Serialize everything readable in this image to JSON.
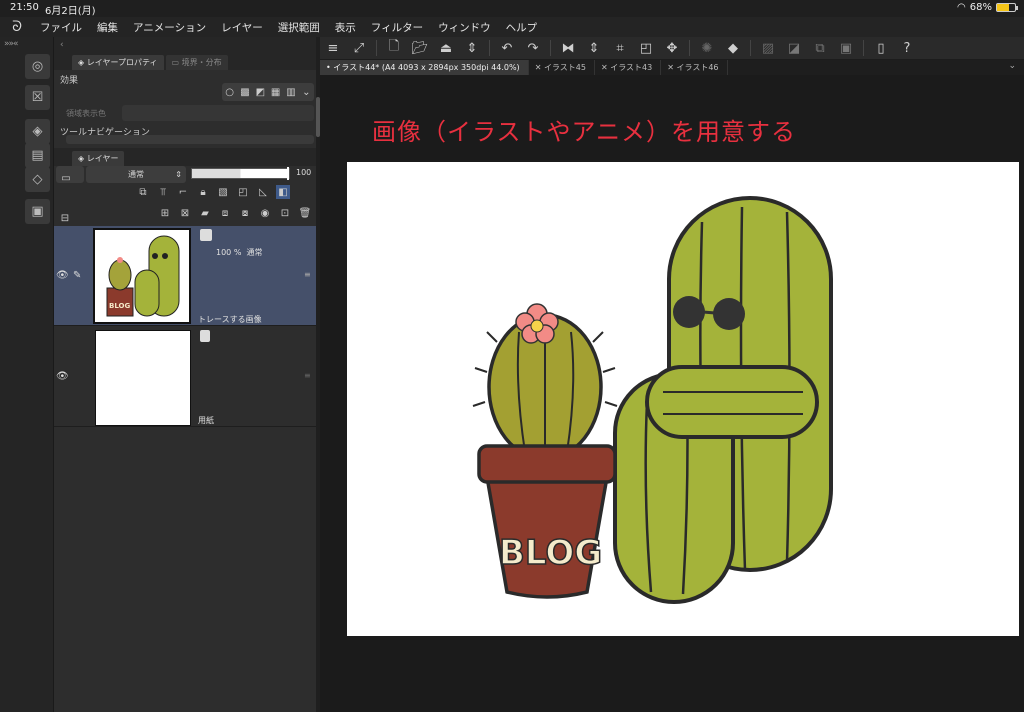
{
  "status": {
    "time": "21:50",
    "date": "6月2日(月)",
    "battery": "68%",
    "battery_level": 0.68
  },
  "menu": {
    "items": [
      "ファイル",
      "編集",
      "アニメーション",
      "レイヤー",
      "選択範囲",
      "表示",
      "フィルター",
      "ウィンドウ",
      "ヘルプ"
    ]
  },
  "panel": {
    "tabs": {
      "layer_property": "レイヤープロパティ",
      "second": "境界・分布"
    },
    "effect_title": "効果",
    "layer_color_label": "領域表示色",
    "tool_nav_title": "ツールナビゲーション",
    "layer_tab": "レイヤー",
    "blend_mode": "通常",
    "opacity_value": "100",
    "layers": [
      {
        "name": "トレースする画像",
        "opacity": "100 %",
        "mode": "通常",
        "selected": true
      },
      {
        "name": "用紙",
        "selected": false
      }
    ]
  },
  "canvas": {
    "tabs": [
      {
        "label": "イラスト44* (A4 4093 x 2894px 350dpi 44.0%)",
        "active": true
      },
      {
        "label": "イラスト45",
        "active": false
      },
      {
        "label": "イラスト43",
        "active": false
      },
      {
        "label": "イラスト46",
        "active": false
      }
    ],
    "caption": "画像（イラストやアニメ）を用意する",
    "pot_text": "BLOG"
  },
  "colors": {
    "caption_red": "#e8303f",
    "cactus_green": "#a4b33a",
    "pot_brown": "#8b3a2c",
    "flower_pink": "#f28b86",
    "selected_layer": "#45506a"
  }
}
